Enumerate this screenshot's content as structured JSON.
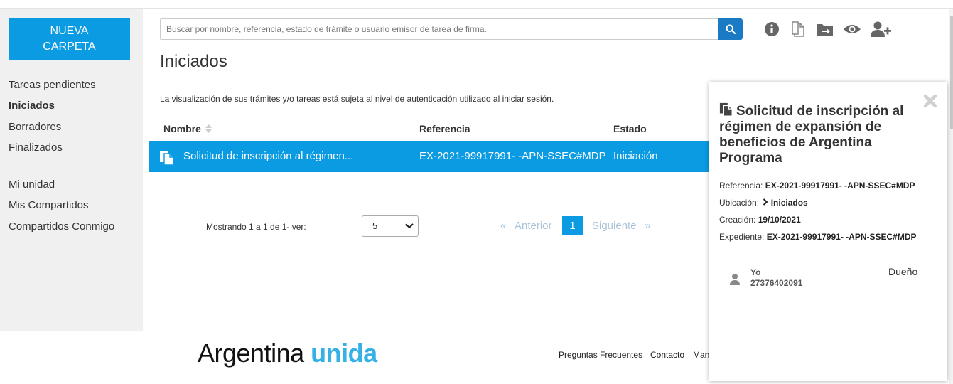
{
  "sidebar": {
    "new_folder": "NUEVA CARPETA",
    "items": [
      {
        "label": "Tareas pendientes"
      },
      {
        "label": "Iniciados"
      },
      {
        "label": "Borradores"
      },
      {
        "label": "Finalizados"
      },
      {
        "label": "Mi unidad"
      },
      {
        "label": "Mis Compartidos"
      },
      {
        "label": "Compartidos Conmigo"
      }
    ],
    "active": "Iniciados"
  },
  "search": {
    "placeholder": "Buscar por nombre, referencia, estado de trámite o usuario emisor de tarea de firma.",
    "value": ""
  },
  "toolbar": {
    "icons": [
      "info-icon",
      "document-icon",
      "move-folder-icon",
      "eye-icon",
      "add-user-icon"
    ]
  },
  "main": {
    "title": "Iniciados",
    "notice": "La visualización de sus trámites y/o tareas está sujeta al nivel de autenticación utilizado al iniciar sesión.",
    "columns": [
      "Nombre",
      "Referencia",
      "Estado"
    ],
    "rows": [
      {
        "name": "Solicitud de inscripción al régimen...",
        "reference": "EX-2021-99917991- -APN-SSEC#MDP",
        "status": "Iniciación",
        "selected": true
      }
    ]
  },
  "pagination": {
    "showing": "Mostrando 1 a 1 de 1- ver:",
    "page_size": "5",
    "prev_glyph": "«",
    "prev": "Anterior",
    "current": "1",
    "next": "Siguiente",
    "next_glyph": "»"
  },
  "footer": {
    "brand_part1": "Argentina",
    "brand_part2": "unida",
    "links": [
      "Preguntas Frecuentes",
      "Contacto",
      "Man"
    ]
  },
  "detail": {
    "title": "Solicitud de inscripción al régimen de expansión de beneficios de Argentina Programa",
    "reference_label": "Referencia:",
    "reference": "EX-2021-99917991- -APN-SSEC#MDP",
    "location_label": "Ubicación:",
    "location": "Iniciados",
    "created_label": "Creación:",
    "created": "19/10/2021",
    "file_label": "Expediente:",
    "file": "EX-2021-99917991- -APN-SSEC#MDP",
    "owner_name": "Yo",
    "owner_id": "27376402091",
    "owner_role": "Dueño"
  },
  "colors": {
    "accent": "#0a9be2",
    "search_button": "#1a7ac4",
    "brand_highlight": "#35b1e5"
  }
}
